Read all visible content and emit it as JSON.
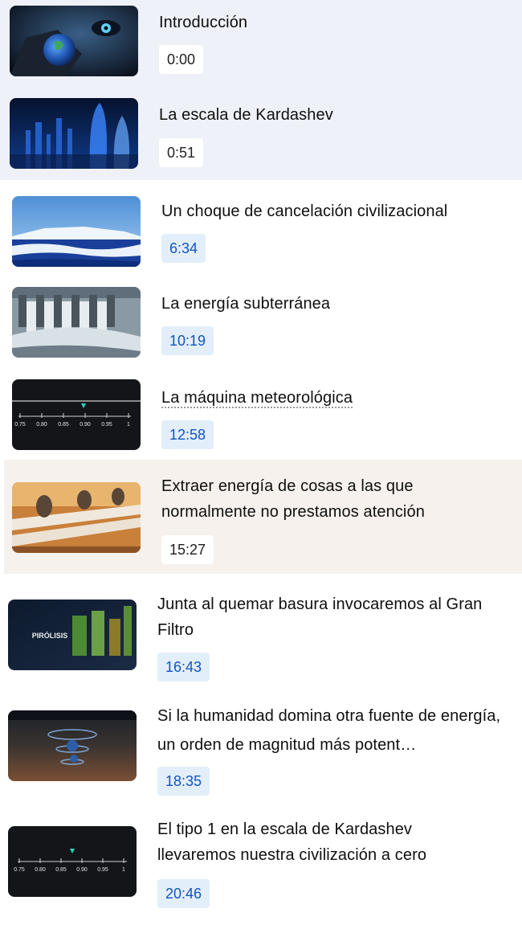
{
  "chapters": [
    {
      "title": "Introducción",
      "time": "0:00",
      "thumb_icon": "earth-in-hand-thumbnail"
    },
    {
      "title": "La escala de Kardashev",
      "time": "0:51",
      "thumb_icon": "futuristic-city-thumbnail"
    },
    {
      "title": "Un choque de cancelación civilizacional",
      "time": "6:34",
      "thumb_icon": "iceberg-ocean-thumbnail"
    },
    {
      "title": "La energía subterránea",
      "time": "10:19",
      "thumb_icon": "dam-thumbnail"
    },
    {
      "title": "La máquina meteorológica",
      "time": "12:58",
      "thumb_icon": "scale-gauge-thumbnail",
      "gauge_labels": [
        "0.75",
        "0.80",
        "0.85",
        "0.90",
        "0.95",
        "1"
      ]
    },
    {
      "title": "Extraer energía de cosas a las que normalmente no prestamos atención",
      "time": "15:27",
      "thumb_icon": "classroom-thumbnail"
    },
    {
      "title": "Junta al quemar basura invocaremos al Gran Filtro",
      "time": "16:43",
      "thumb_icon": "pyrolysis-thumbnail",
      "thumb_text": "PIRÓLISIS"
    },
    {
      "title": "Si la humanidad domina otra fuente de energía, un orden de magnitud más potent…",
      "time": "18:35",
      "thumb_icon": "spiral-orbit-thumbnail"
    },
    {
      "title": "El tipo 1 en la escala de Kardashev llevaremos nuestra civilización a cero",
      "time": "20:46",
      "thumb_icon": "scale-gauge-thumbnail",
      "gauge_labels": [
        "0.75",
        "0.80",
        "0.85",
        "0.90",
        "0.95",
        "1"
      ]
    }
  ],
  "colors": {
    "active_bg": "#eef1f7",
    "hover_bg": "#f6f1ec",
    "timestamp_bg": "#e3eefb",
    "timestamp_text": "#1054c4"
  }
}
